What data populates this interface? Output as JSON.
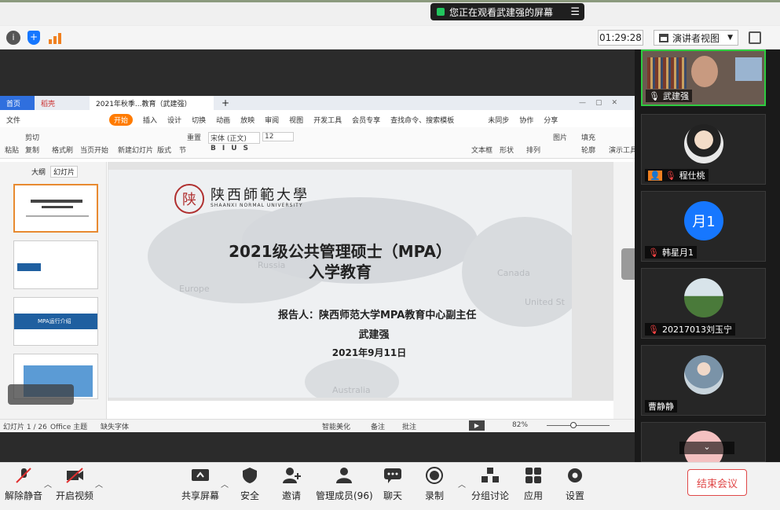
{
  "banner": {
    "text": "您正在观看武建强的屏幕"
  },
  "timer": "01:29:28",
  "view_mode": "演讲者视图",
  "wps": {
    "tabs": [
      "首页",
      "稻壳",
      "2021年秋季...教育（武建强）"
    ],
    "menu": [
      "文件",
      "开始",
      "插入",
      "设计",
      "切换",
      "动画",
      "放映",
      "审阅",
      "视图",
      "开发工具",
      "会员专享",
      "查找命令、搜索模板",
      "未同步",
      "协作",
      "分享"
    ],
    "ribbon": [
      "粘贴",
      "剪切",
      "复制",
      "格式刷",
      "当页开始",
      "新建幻灯片",
      "版式",
      "节",
      "重置",
      "宋体 (正文)",
      "12",
      "文本框",
      "形状",
      "排列",
      "图片",
      "填充",
      "轮廓",
      "演示工具"
    ],
    "panel_tabs": [
      "大纲",
      "幻灯片"
    ],
    "thumb_labels": [
      "MPA运行介绍"
    ],
    "status": {
      "slide": "幻灯片 1 / 26",
      "theme": "Office 主题",
      "font": "缺失字体",
      "beautify": "智能美化",
      "notes": "备注",
      "comment": "批注",
      "zoom": "82%"
    }
  },
  "slide": {
    "school_cn": "陕西師範大學",
    "school_en": "SHAANXI NORMAL UNIVERSITY",
    "seal": "陕",
    "title1": "2021级公共管理硕士（MPA）",
    "title2": "入学教育",
    "reporter": "报告人：陕西师范大学MPA教育中心副主任",
    "name": "武建强",
    "date": "2021年9月11日",
    "map_labels": [
      "Russia",
      "Canada",
      "Europe",
      "United St",
      "Australia"
    ]
  },
  "participants": [
    {
      "name": "武建强"
    },
    {
      "name": "程仕桃"
    },
    {
      "name": "韩星月1",
      "initials": "月1"
    },
    {
      "name": "20217013刘玉宁"
    },
    {
      "name": "曹静静"
    }
  ],
  "controls": [
    "解除静音",
    "开启视频",
    "共享屏幕",
    "安全",
    "邀请",
    "管理成员(96)",
    "聊天",
    "录制",
    "分组讨论",
    "应用",
    "设置"
  ],
  "end_button": "结束会议",
  "colors": {
    "accent_orange": "#ff7b00",
    "end_red": "#e04848",
    "avatar_blue": "#1677ff",
    "slide_blue": "#1f5fa0"
  }
}
